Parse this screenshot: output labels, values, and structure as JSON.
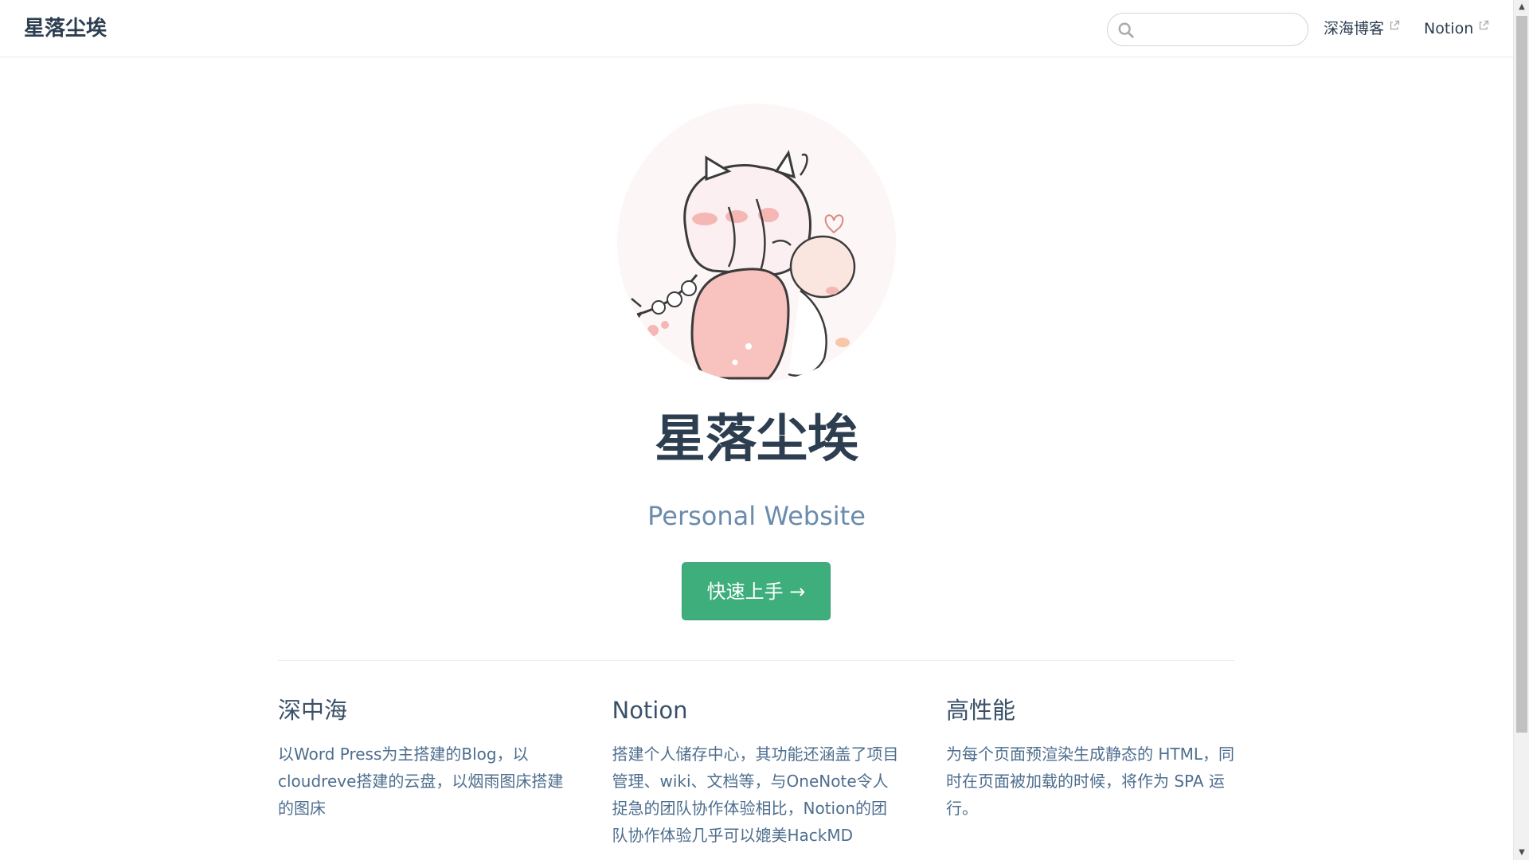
{
  "navbar": {
    "site_name": "星落尘埃",
    "search": {
      "placeholder": "",
      "value": ""
    },
    "links": [
      {
        "label": "深海博客",
        "external": true
      },
      {
        "label": "Notion",
        "external": true
      }
    ]
  },
  "hero": {
    "title": "星落尘埃",
    "description": "Personal Website",
    "action_label": "快速上手 →"
  },
  "features": [
    {
      "title": "深中海",
      "details": "以Word Press为主搭建的Blog，以cloudreve搭建的云盘，以烟雨图床搭建的图床"
    },
    {
      "title": "Notion",
      "details": "搭建个人储存中心，其功能还涵盖了项目管理、wiki、文档等，与OneNote令人捉急的团队协作体验相比，Notion的团队协作体验几乎可以媲美HackMD"
    },
    {
      "title": "高性能",
      "details": "为每个页面预渲染生成静态的 HTML，同时在页面被加载的时候，将作为 SPA 运行。"
    }
  ],
  "colors": {
    "accent": "#3eaf7c",
    "text": "#2c3e50",
    "description": "#6a8bad"
  },
  "icons": {
    "search": "search-icon",
    "external": "external-link-icon"
  }
}
